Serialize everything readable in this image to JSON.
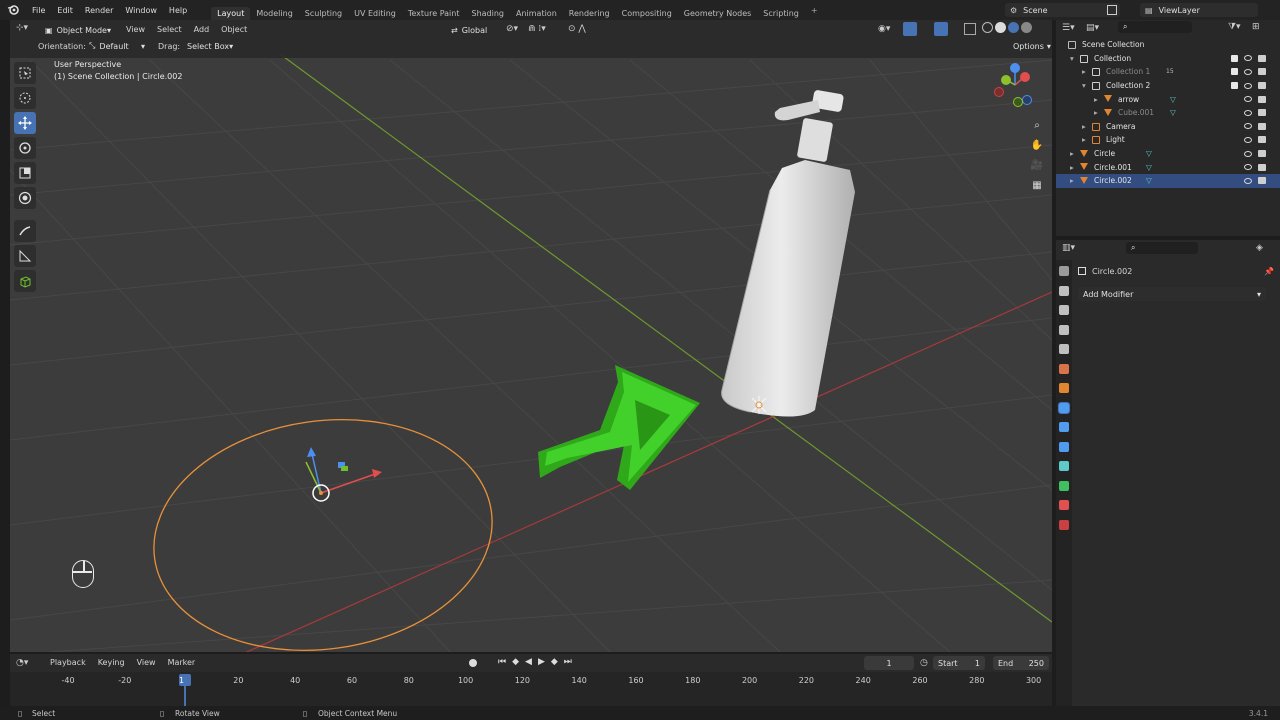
{
  "menu": {
    "items": [
      "File",
      "Edit",
      "Render",
      "Window",
      "Help"
    ],
    "workspace_tabs": [
      "Layout",
      "Modeling",
      "Sculpting",
      "UV Editing",
      "Texture Paint",
      "Shading",
      "Animation",
      "Rendering",
      "Compositing",
      "Geometry Nodes",
      "Scripting"
    ],
    "active_tab": "Layout",
    "add_tab": "+",
    "scene": "Scene",
    "view_layer": "ViewLayer"
  },
  "viewport_header": {
    "mode": "Object Mode",
    "menus": [
      "View",
      "Select",
      "Add",
      "Object"
    ],
    "transform_orientation": "Global",
    "orientation_label": "Orientation:",
    "orientation_value": "Default",
    "drag_label": "Drag:",
    "drag_value": "Select Box",
    "options": "Options"
  },
  "viewport": {
    "view_name": "User Perspective",
    "context": "(1) Scene Collection | Circle.002",
    "axes": {
      "x": "X",
      "y": "Y",
      "z": "Z"
    }
  },
  "outliner": {
    "search_placeholder": "",
    "rows": [
      {
        "label": "Scene Collection",
        "indent": 0,
        "expander": "",
        "icon": "scene-collection-icon",
        "dim": false,
        "selected": false,
        "check": false,
        "extra": ""
      },
      {
        "label": "Collection",
        "indent": 1,
        "expander": "▾",
        "icon": "collection-icon",
        "dim": false,
        "selected": false,
        "check": true,
        "extra": ""
      },
      {
        "label": "Collection 1",
        "indent": 2,
        "expander": "▸",
        "icon": "collection-icon",
        "dim": true,
        "selected": false,
        "check": true,
        "extra": "15"
      },
      {
        "label": "Collection 2",
        "indent": 2,
        "expander": "▾",
        "icon": "collection-icon",
        "dim": false,
        "selected": false,
        "check": true,
        "extra": ""
      },
      {
        "label": "arrow",
        "indent": 3,
        "expander": "▸",
        "icon": "mesh-object-icon",
        "dim": false,
        "selected": false,
        "check": false,
        "extra": ""
      },
      {
        "label": "Cube.001",
        "indent": 3,
        "expander": "▸",
        "icon": "mesh-object-icon",
        "dim": true,
        "selected": false,
        "check": false,
        "extra": ""
      },
      {
        "label": "Camera",
        "indent": 2,
        "expander": "▸",
        "icon": "camera-object-icon",
        "dim": false,
        "selected": false,
        "check": false,
        "extra": ""
      },
      {
        "label": "Light",
        "indent": 2,
        "expander": "▸",
        "icon": "light-object-icon",
        "dim": false,
        "selected": false,
        "check": false,
        "extra": ""
      },
      {
        "label": "Circle",
        "indent": 1,
        "expander": "▸",
        "icon": "mesh-object-icon",
        "dim": false,
        "selected": false,
        "check": false,
        "extra": ""
      },
      {
        "label": "Circle.001",
        "indent": 1,
        "expander": "▸",
        "icon": "mesh-object-icon",
        "dim": false,
        "selected": false,
        "check": false,
        "extra": ""
      },
      {
        "label": "Circle.002",
        "indent": 1,
        "expander": "▸",
        "icon": "mesh-object-icon",
        "dim": false,
        "selected": true,
        "check": false,
        "extra": ""
      }
    ]
  },
  "properties": {
    "object_name": "Circle.002",
    "add_modifier": "Add Modifier",
    "tab_colors": [
      "#9a9a9a",
      "#c0c0c0",
      "#c0c0c0",
      "#c0c0c0",
      "#c0c0c0",
      "#d8734a",
      "#e08530",
      "#4f9cf0",
      "#4f9cf0",
      "#4f9cf0",
      "#5fc9c9",
      "#3fbf5f",
      "#e05050",
      "#c84040"
    ]
  },
  "timeline": {
    "menus": [
      "Playback",
      "Keying",
      "View",
      "Marker"
    ],
    "current_frame": "1",
    "start_label": "Start",
    "start": "1",
    "end_label": "End",
    "end": "250",
    "ticks": [
      "-40",
      "-20",
      "1",
      "20",
      "40",
      "60",
      "80",
      "100",
      "120",
      "140",
      "160",
      "180",
      "200",
      "220",
      "240",
      "260",
      "280",
      "300"
    ]
  },
  "status": {
    "select": "Select",
    "rotate": "Rotate View",
    "context_menu": "Object Context Menu",
    "version": "3.4.1"
  },
  "colors": {
    "accent": "#4772b3",
    "selection_orange": "#e8913a",
    "arrow_green": "#33c41a",
    "x_axis": "#d04040",
    "y_axis": "#7ab82e"
  }
}
